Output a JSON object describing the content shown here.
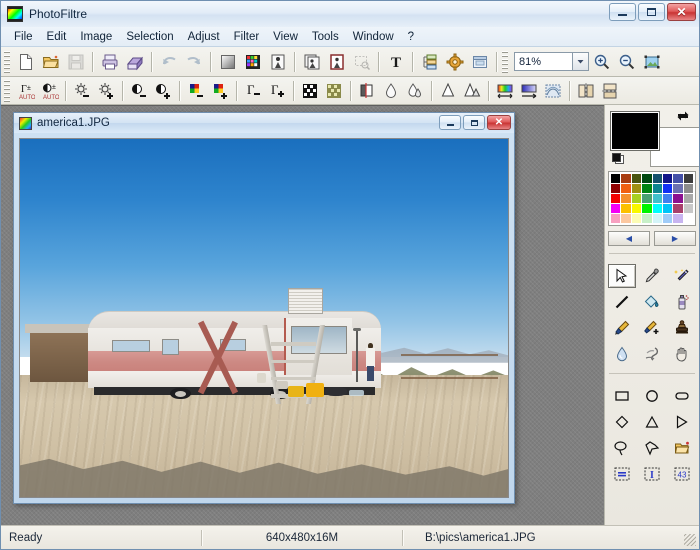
{
  "window": {
    "title": "PhotoFiltre",
    "app_icon": "photofiltre-logo-icon",
    "buttons": {
      "minimize": "minimize-icon",
      "maximize": "maximize-icon",
      "close": "close-icon"
    }
  },
  "menubar": {
    "items": [
      {
        "label": "File"
      },
      {
        "label": "Edit"
      },
      {
        "label": "Image"
      },
      {
        "label": "Selection"
      },
      {
        "label": "Adjust"
      },
      {
        "label": "Filter"
      },
      {
        "label": "View"
      },
      {
        "label": "Tools"
      },
      {
        "label": "Window"
      },
      {
        "label": "?"
      }
    ]
  },
  "toolbar_main": {
    "groups": [
      {
        "buttons": [
          {
            "name": "new-file-icon",
            "title": "New",
            "disabled": false
          },
          {
            "name": "open-file-icon",
            "title": "Open",
            "disabled": false
          },
          {
            "name": "save-file-icon",
            "title": "Save",
            "disabled": true
          }
        ]
      },
      {
        "buttons": [
          {
            "name": "print-icon",
            "title": "Print",
            "disabled": false
          },
          {
            "name": "print-preview-icon",
            "title": "Print preview",
            "disabled": false
          }
        ]
      },
      {
        "buttons": [
          {
            "name": "undo-icon",
            "title": "Undo",
            "disabled": true
          },
          {
            "name": "redo-icon",
            "title": "Redo",
            "disabled": true
          }
        ]
      },
      {
        "buttons": [
          {
            "name": "grayscale-icon",
            "title": "Grayscale",
            "disabled": false
          },
          {
            "name": "color-palette-icon",
            "title": "Palette",
            "disabled": false
          },
          {
            "name": "image-effect-icon",
            "title": "Effect",
            "disabled": false
          }
        ]
      },
      {
        "buttons": [
          {
            "name": "duplicate-image-icon",
            "title": "Duplicate",
            "disabled": false
          },
          {
            "name": "framed-image-icon",
            "title": "Frame",
            "disabled": false
          },
          {
            "name": "crop-selection-icon",
            "title": "Crop",
            "disabled": true
          }
        ]
      },
      {
        "buttons": [
          {
            "name": "text-tool-icon",
            "title": "Text",
            "disabled": false
          }
        ]
      },
      {
        "buttons": [
          {
            "name": "layers-icon",
            "title": "Layers",
            "disabled": false
          },
          {
            "name": "settings-gear-icon",
            "title": "Preferences",
            "disabled": false
          },
          {
            "name": "show-window-icon",
            "title": "Window",
            "disabled": false
          }
        ]
      }
    ],
    "zoom": {
      "value": "81%",
      "dropdown": "chevron-down-icon"
    },
    "zoom_buttons": [
      {
        "name": "zoom-in-icon",
        "title": "Zoom in"
      },
      {
        "name": "zoom-out-icon",
        "title": "Zoom out"
      },
      {
        "name": "fit-to-screen-icon",
        "title": "Fit to screen"
      }
    ]
  },
  "toolbar_filters": {
    "groups": [
      {
        "buttons": [
          {
            "name": "auto-levels-icon",
            "title": "Auto levels"
          },
          {
            "name": "auto-contrast-icon",
            "title": "Auto contrast"
          }
        ]
      },
      {
        "buttons": [
          {
            "name": "brightness-down-icon",
            "title": "Brightness -"
          },
          {
            "name": "brightness-up-icon",
            "title": "Brightness +"
          }
        ]
      },
      {
        "buttons": [
          {
            "name": "contrast-down-icon",
            "title": "Contrast -"
          },
          {
            "name": "contrast-up-icon",
            "title": "Contrast +"
          }
        ]
      },
      {
        "buttons": [
          {
            "name": "saturation-down-icon",
            "title": "Saturation -"
          },
          {
            "name": "saturation-up-icon",
            "title": "Saturation +"
          }
        ]
      },
      {
        "buttons": [
          {
            "name": "gamma-down-icon",
            "title": "Gamma -"
          },
          {
            "name": "gamma-up-icon",
            "title": "Gamma +"
          }
        ]
      },
      {
        "buttons": [
          {
            "name": "dither-dark-icon",
            "title": "Dither"
          },
          {
            "name": "dither-light-icon",
            "title": "Halftone"
          }
        ]
      },
      {
        "buttons": [
          {
            "name": "split-compare-icon",
            "title": "Split view"
          },
          {
            "name": "blur-drop-icon",
            "title": "Blur"
          },
          {
            "name": "blur-more-icon",
            "title": "Blur more"
          }
        ]
      },
      {
        "buttons": [
          {
            "name": "sharpen-icon",
            "title": "Sharpen"
          },
          {
            "name": "sharpen-more-icon",
            "title": "Sharpen more"
          }
        ]
      },
      {
        "buttons": [
          {
            "name": "gradient-rainbow-icon",
            "title": "Gradient"
          },
          {
            "name": "gradient-linear-icon",
            "title": "Linear gradient"
          },
          {
            "name": "texture-icon",
            "title": "Texture"
          }
        ]
      },
      {
        "buttons": [
          {
            "name": "flip-horizontal-icon",
            "title": "Flip horizontal"
          },
          {
            "name": "flip-vertical-icon",
            "title": "Flip vertical"
          }
        ]
      }
    ]
  },
  "child_window": {
    "title": "america1.JPG",
    "icon": "image-thumbnail-icon",
    "buttons": {
      "minimize": "minimize-icon",
      "maximize": "maximize-icon",
      "close": "close-icon"
    }
  },
  "color_panel": {
    "foreground": "#000000",
    "background": "#ffffff",
    "swap_icon": "swap-colors-icon",
    "default_icon": "default-colors-icon",
    "palette_rows": [
      [
        "#000000",
        "#a83c10",
        "#4a5410",
        "#004810",
        "#14506c",
        "#101488",
        "#4450a8",
        "#3c3c3c"
      ],
      [
        "#900000",
        "#f06010",
        "#a09010",
        "#008410",
        "#0c8490",
        "#1030f4",
        "#6c70b0",
        "#8c8c8c"
      ],
      [
        "#f40000",
        "#f4902c",
        "#a8d020",
        "#48a070",
        "#40c0cc",
        "#4080f0",
        "#8c1090",
        "#a8a8a8"
      ],
      [
        "#f400f4",
        "#fcc000",
        "#f8f800",
        "#00f400",
        "#00fcfc",
        "#00c4f8",
        "#a8406c",
        "#c8c8c8"
      ],
      [
        "#f8a0c0",
        "#fcc8a0",
        "#fcfcb4",
        "#c8f0c8",
        "#d4f4f8",
        "#a0ccf8",
        "#c8b4f0",
        "#ffffff"
      ]
    ],
    "nav_prev": "◀",
    "nav_next": "▶"
  },
  "tools": {
    "items": [
      {
        "name": "tool-select-arrow",
        "label": "Selection",
        "active": true
      },
      {
        "name": "tool-eyedropper",
        "label": "Color picker",
        "active": false
      },
      {
        "name": "tool-magic-wand",
        "label": "Magic wand",
        "active": false
      },
      {
        "name": "tool-line",
        "label": "Line",
        "active": false
      },
      {
        "name": "tool-paint-bucket",
        "label": "Fill",
        "active": false
      },
      {
        "name": "tool-spray",
        "label": "Spray",
        "active": false
      },
      {
        "name": "tool-paintbrush",
        "label": "Paintbrush",
        "active": false
      },
      {
        "name": "tool-advanced-brush",
        "label": "Advanced brush",
        "active": false
      },
      {
        "name": "tool-clone-stamp",
        "label": "Clone stamp",
        "active": false
      },
      {
        "name": "tool-blur-drop",
        "label": "Blur",
        "active": false
      },
      {
        "name": "tool-smudge",
        "label": "Smudge",
        "active": false
      },
      {
        "name": "tool-hand",
        "label": "Hand",
        "active": false
      }
    ],
    "shapes": [
      {
        "name": "shape-rectangle",
        "label": "Rectangle"
      },
      {
        "name": "shape-ellipse",
        "label": "Ellipse"
      },
      {
        "name": "shape-rounded-rectangle",
        "label": "Rounded rectangle"
      },
      {
        "name": "shape-diamond",
        "label": "Diamond"
      },
      {
        "name": "shape-triangle",
        "label": "Triangle"
      },
      {
        "name": "shape-right-triangle",
        "label": "Right triangle"
      },
      {
        "name": "shape-lasso",
        "label": "Lasso"
      },
      {
        "name": "shape-polygon",
        "label": "Polygon"
      },
      {
        "name": "shape-load-selection",
        "label": "Load selection"
      },
      {
        "name": "option-fill-mode",
        "label": "Fill mode"
      },
      {
        "name": "option-invert-selection",
        "label": "Invert selection"
      },
      {
        "name": "option-selection-size",
        "label": "Selection size"
      }
    ]
  },
  "statusbar": {
    "state": "Ready",
    "dimensions": "640x480x16M",
    "filepath": "B:\\pics\\america1.JPG",
    "resize_grip": "resize-grip-icon"
  }
}
